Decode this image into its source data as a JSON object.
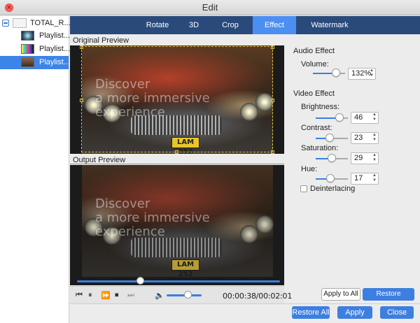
{
  "window": {
    "title": "Edit"
  },
  "sidebar": {
    "root_label": "TOTAL_R...",
    "items": [
      {
        "label": "Playlist..."
      },
      {
        "label": "Playlist..."
      },
      {
        "label": "Playlist..."
      }
    ],
    "selected_index": 2
  },
  "tabs": [
    {
      "label": "Rotate"
    },
    {
      "label": "3D"
    },
    {
      "label": "Crop"
    },
    {
      "label": "Effect"
    },
    {
      "label": "Watermark"
    }
  ],
  "active_tab": "Effect",
  "previews": {
    "original_label": "Original Preview",
    "output_label": "Output Preview",
    "watermark_lines": [
      "Discover",
      "a more immersive",
      "experience"
    ],
    "plate_text": "LAM 252"
  },
  "player": {
    "time": "00:00:38/00:02:01",
    "seek_fraction": 0.31,
    "volume_fraction": 0.6
  },
  "audio_effect": {
    "title": "Audio Effect",
    "volume": {
      "label": "Volume:",
      "value": "132%"
    }
  },
  "video_effect": {
    "title": "Video Effect",
    "brightness": {
      "label": "Brightness:",
      "value": "46"
    },
    "contrast": {
      "label": "Contrast:",
      "value": "23"
    },
    "saturation": {
      "label": "Saturation:",
      "value": "29"
    },
    "hue": {
      "label": "Hue:",
      "value": "17"
    },
    "deinterlacing": {
      "label": "Deinterlacing",
      "checked": false
    }
  },
  "buttons": {
    "apply_to_all": "Apply to All",
    "restore_defaults": "Restore Defaults",
    "restore_all": "Restore All",
    "apply": "Apply",
    "close": "Close"
  },
  "colors": {
    "accent": "#3d7fe0",
    "tab_bar": "#2a4a7c",
    "tab_active": "#4d8ef1",
    "selection": "#3d84e8"
  }
}
